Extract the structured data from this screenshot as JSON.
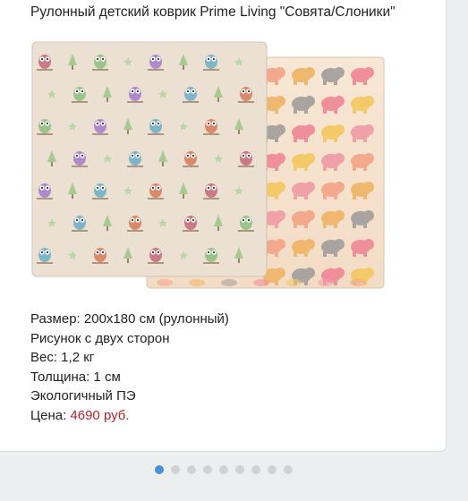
{
  "product": {
    "title": "Рулонный детский коврик Prime Living \"Совята/Слоники\""
  },
  "specs": {
    "size": "Размер: 200х180 см (рулонный)",
    "pattern": "Рисунок с двух сторон",
    "weight": "Вес: 1,2 кг",
    "thickness": "Толщина: 1 см",
    "material": "Экологичный ПЭ",
    "price_label": "Цена: ",
    "price_value": "4690 руб."
  },
  "carousel": {
    "total": 9,
    "active_index": 0,
    "colors": {
      "active": "#4a90d9",
      "inactive": "#cfd3d8"
    }
  },
  "images": {
    "front_side": "owl-pattern-mat",
    "back_side": "elephant-pattern-mat"
  }
}
